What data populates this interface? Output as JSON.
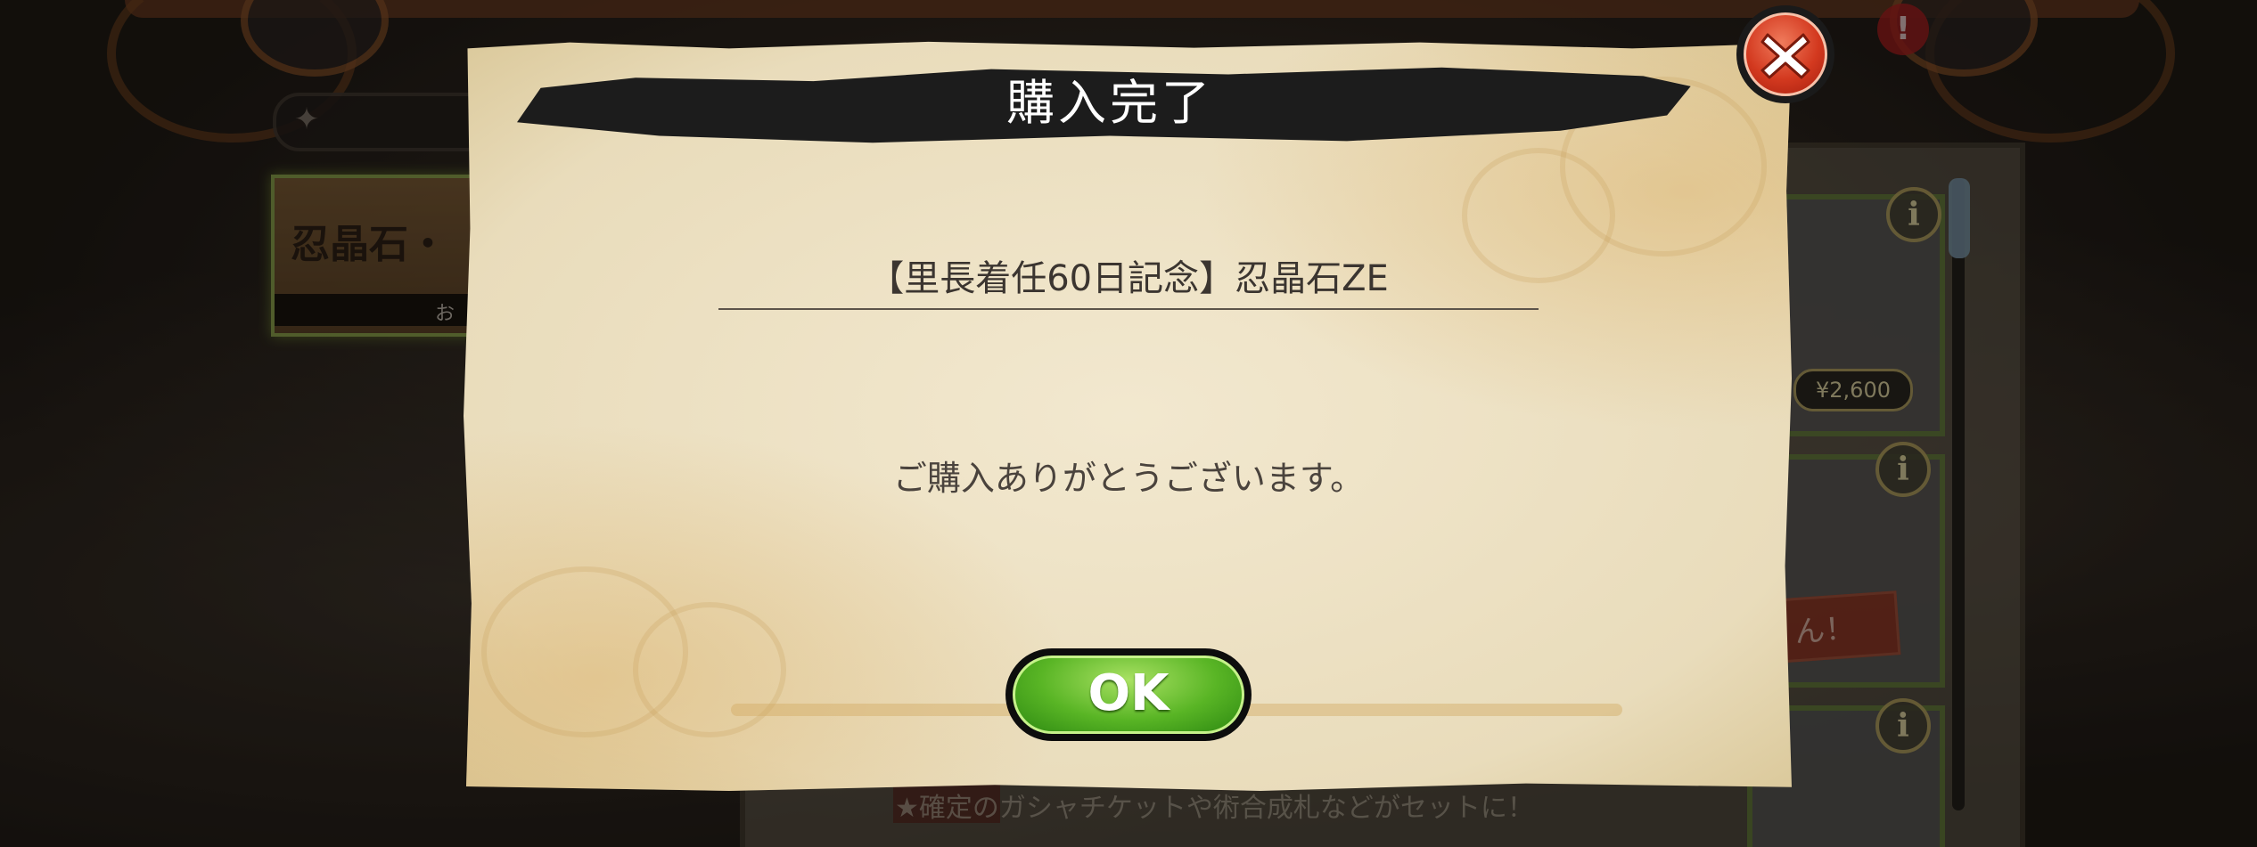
{
  "background": {
    "alert_badge": "!",
    "category_card_title": "忍晶石・",
    "category_strip_text": "お",
    "info_icon": "i",
    "price_label": "¥2,600",
    "tag_text": "ん！",
    "bottom_text": "★確定のガシャチケットや術合成札などがセットに！"
  },
  "dialog": {
    "title": "購入完了",
    "item_name": "【里長着任60日記念】忍晶石ZE",
    "message": "ご購入ありがとうございます。",
    "ok_label": "OK"
  },
  "icons": {
    "close": "close-icon",
    "search": "shuriken-icon",
    "info": "info-icon"
  },
  "colors": {
    "ok_green": "#59b525",
    "close_red": "#d3391f",
    "banner_black": "#1c1c1c",
    "parchment": "#efe4c8"
  }
}
